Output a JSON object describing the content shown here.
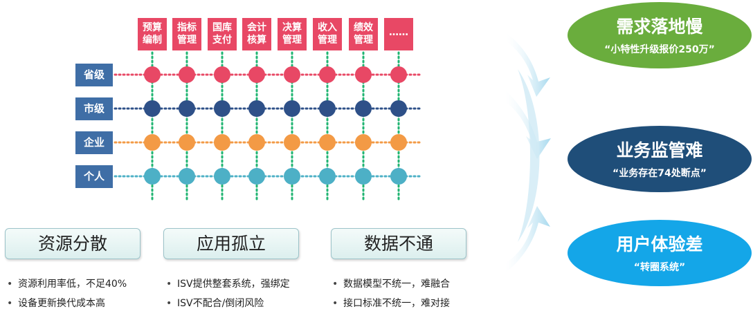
{
  "columns": [
    [
      "预算",
      "编制"
    ],
    [
      "指标",
      "管理"
    ],
    [
      "国库",
      "支付"
    ],
    [
      "会计",
      "核算"
    ],
    [
      "决算",
      "管理"
    ],
    [
      "收入",
      "管理"
    ],
    [
      "绩效",
      "管理"
    ],
    [
      "……",
      ""
    ]
  ],
  "rows": [
    {
      "label": "省级",
      "color": "#e84865"
    },
    {
      "label": "市级",
      "color": "#2e5088"
    },
    {
      "label": "企业",
      "color": "#f39a45"
    },
    {
      "label": "个人",
      "color": "#4db0c6"
    }
  ],
  "grid_line_color": "#22b573",
  "problems": [
    {
      "title": "资源分散",
      "bullets": [
        "资源利用率低，不足40%",
        "设备更新换代成本高"
      ]
    },
    {
      "title": "应用孤立",
      "bullets": [
        "ISV提供整套系统，强绑定",
        "ISV不配合/倒闭风险"
      ]
    },
    {
      "title": "数据不通",
      "bullets": [
        "数据模型不统一，难融合",
        "接口标准不统一，难对接"
      ]
    }
  ],
  "bullet_symbol": "•",
  "outcomes": [
    {
      "title": "需求落地慢",
      "quote": "“小特性升级报价250万”",
      "color": "#6aad3d"
    },
    {
      "title": "业务监管难",
      "quote": "“业务存在74处断点”",
      "color": "#1f4e79"
    },
    {
      "title": "用户体验差",
      "quote": "“转圈系统”",
      "color": "#14a6e8"
    }
  ]
}
